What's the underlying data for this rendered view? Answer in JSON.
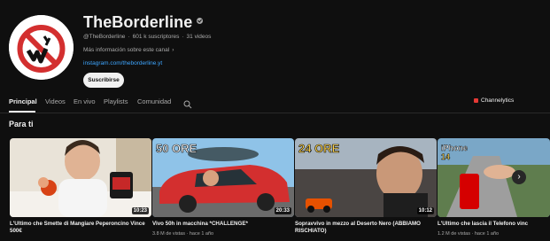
{
  "channel": {
    "name": "TheBorderline",
    "handle": "@TheBorderline",
    "subscribers": "601 k suscriptores",
    "videos": "31 videos",
    "more_info": "Más información sobre este canal",
    "link": "instagram.com/theborderline.yt",
    "subscribe_label": "Suscribirse"
  },
  "tabs": [
    {
      "label": "Principal"
    },
    {
      "label": "Videos"
    },
    {
      "label": "En vivo"
    },
    {
      "label": "Playlists"
    },
    {
      "label": "Comunidad"
    }
  ],
  "extension_label": "Channelytics",
  "section_title": "Para ti",
  "videos": [
    {
      "title_line1": "L'Ultimo che Smette di Mangiare Peperoncino Vince",
      "title_line2": "500€",
      "meta": "",
      "duration": "10:23"
    },
    {
      "title_line1": "Vivo 50h in macchina *CHALLENGE*",
      "title_line2": "",
      "meta": "3.8 M de vistas · hace 1 año",
      "duration": "20:33",
      "overlay": "50 ORE"
    },
    {
      "title_line1": "Sopravvivo in mezzo al Deserto Nero (ABBIAMO",
      "title_line2": "RISCHIATO)",
      "meta": "",
      "duration": "10:12",
      "overlay": "24 ORE"
    },
    {
      "title_line1": "L'Ultimo che lascia il Telefono vinc",
      "title_line2": "",
      "meta": "1.2 M de vistas · hace 1 año",
      "duration": "",
      "overlay_line1": "iPhone",
      "overlay_line2": "14"
    }
  ],
  "colors": {
    "background": "#0f0f0f",
    "link": "#3ea6ff",
    "subscribe_bg": "#f1f1f1",
    "muted_text": "#aaaaaa"
  }
}
